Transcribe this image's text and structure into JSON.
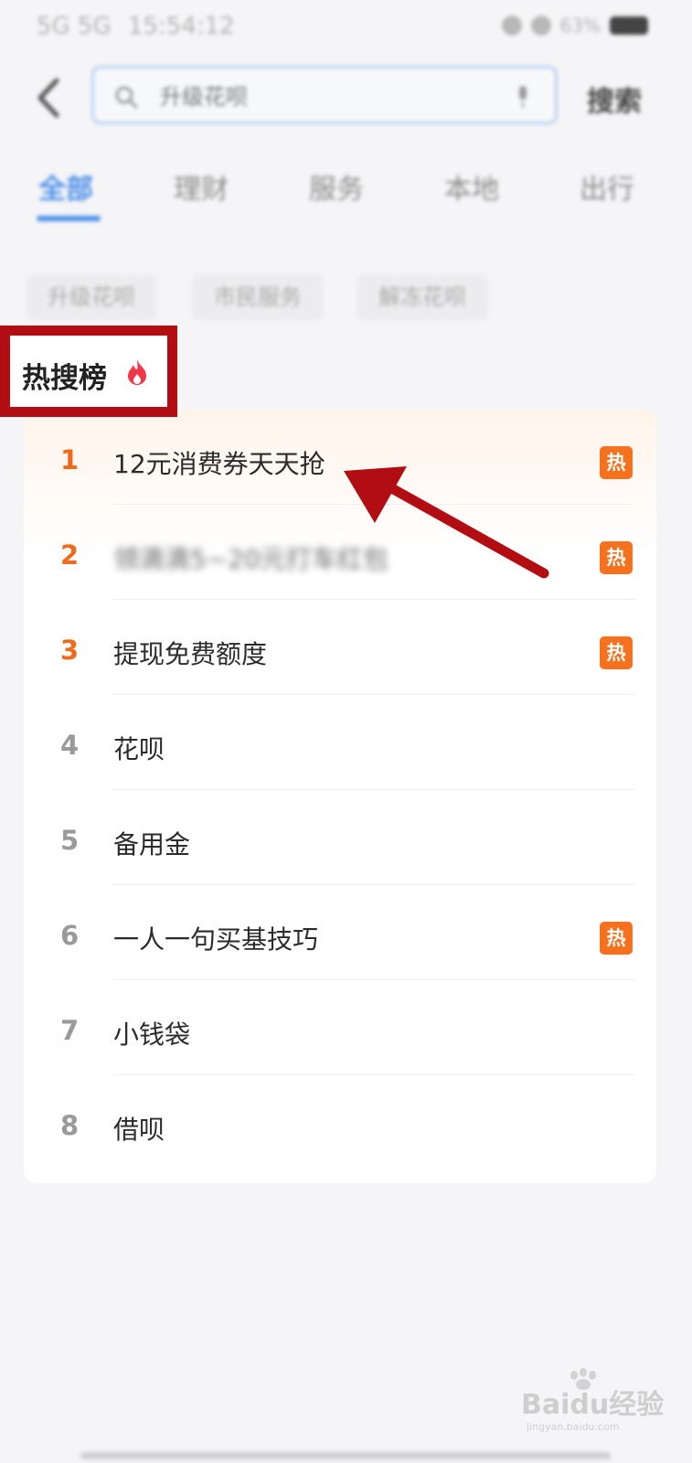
{
  "status_bar": {
    "network": "5G 5G",
    "time": "15:54:12",
    "battery": "63%"
  },
  "header": {
    "search_placeholder": "升级花呗",
    "search_button": "搜索"
  },
  "tabs": [
    {
      "label": "全部",
      "active": true
    },
    {
      "label": "理财",
      "active": false
    },
    {
      "label": "服务",
      "active": false
    },
    {
      "label": "本地",
      "active": false
    },
    {
      "label": "出行",
      "active": false
    }
  ],
  "chips": [
    "升级花呗",
    "市民服务",
    "解冻花呗"
  ],
  "hot_search": {
    "title": "热搜榜",
    "badge_text": "热",
    "items": [
      {
        "rank": "1",
        "label": "12元消费券天天抢",
        "hot": true
      },
      {
        "rank": "2",
        "label": "领滴滴5~20元打车红包",
        "hot": true
      },
      {
        "rank": "3",
        "label": "提现免费额度",
        "hot": true
      },
      {
        "rank": "4",
        "label": "花呗",
        "hot": false
      },
      {
        "rank": "5",
        "label": "备用金",
        "hot": false
      },
      {
        "rank": "6",
        "label": "一人一句买基技巧",
        "hot": true
      },
      {
        "rank": "7",
        "label": "小钱袋",
        "hot": false
      },
      {
        "rank": "8",
        "label": "借呗",
        "hot": false
      }
    ]
  },
  "watermark": {
    "text": "Baidu经验",
    "subtext": "jingyan.baidu.com"
  },
  "colors": {
    "accent_blue": "#4a8ee8",
    "hot_orange": "#f5711e",
    "annotation_red": "#b10d12"
  }
}
